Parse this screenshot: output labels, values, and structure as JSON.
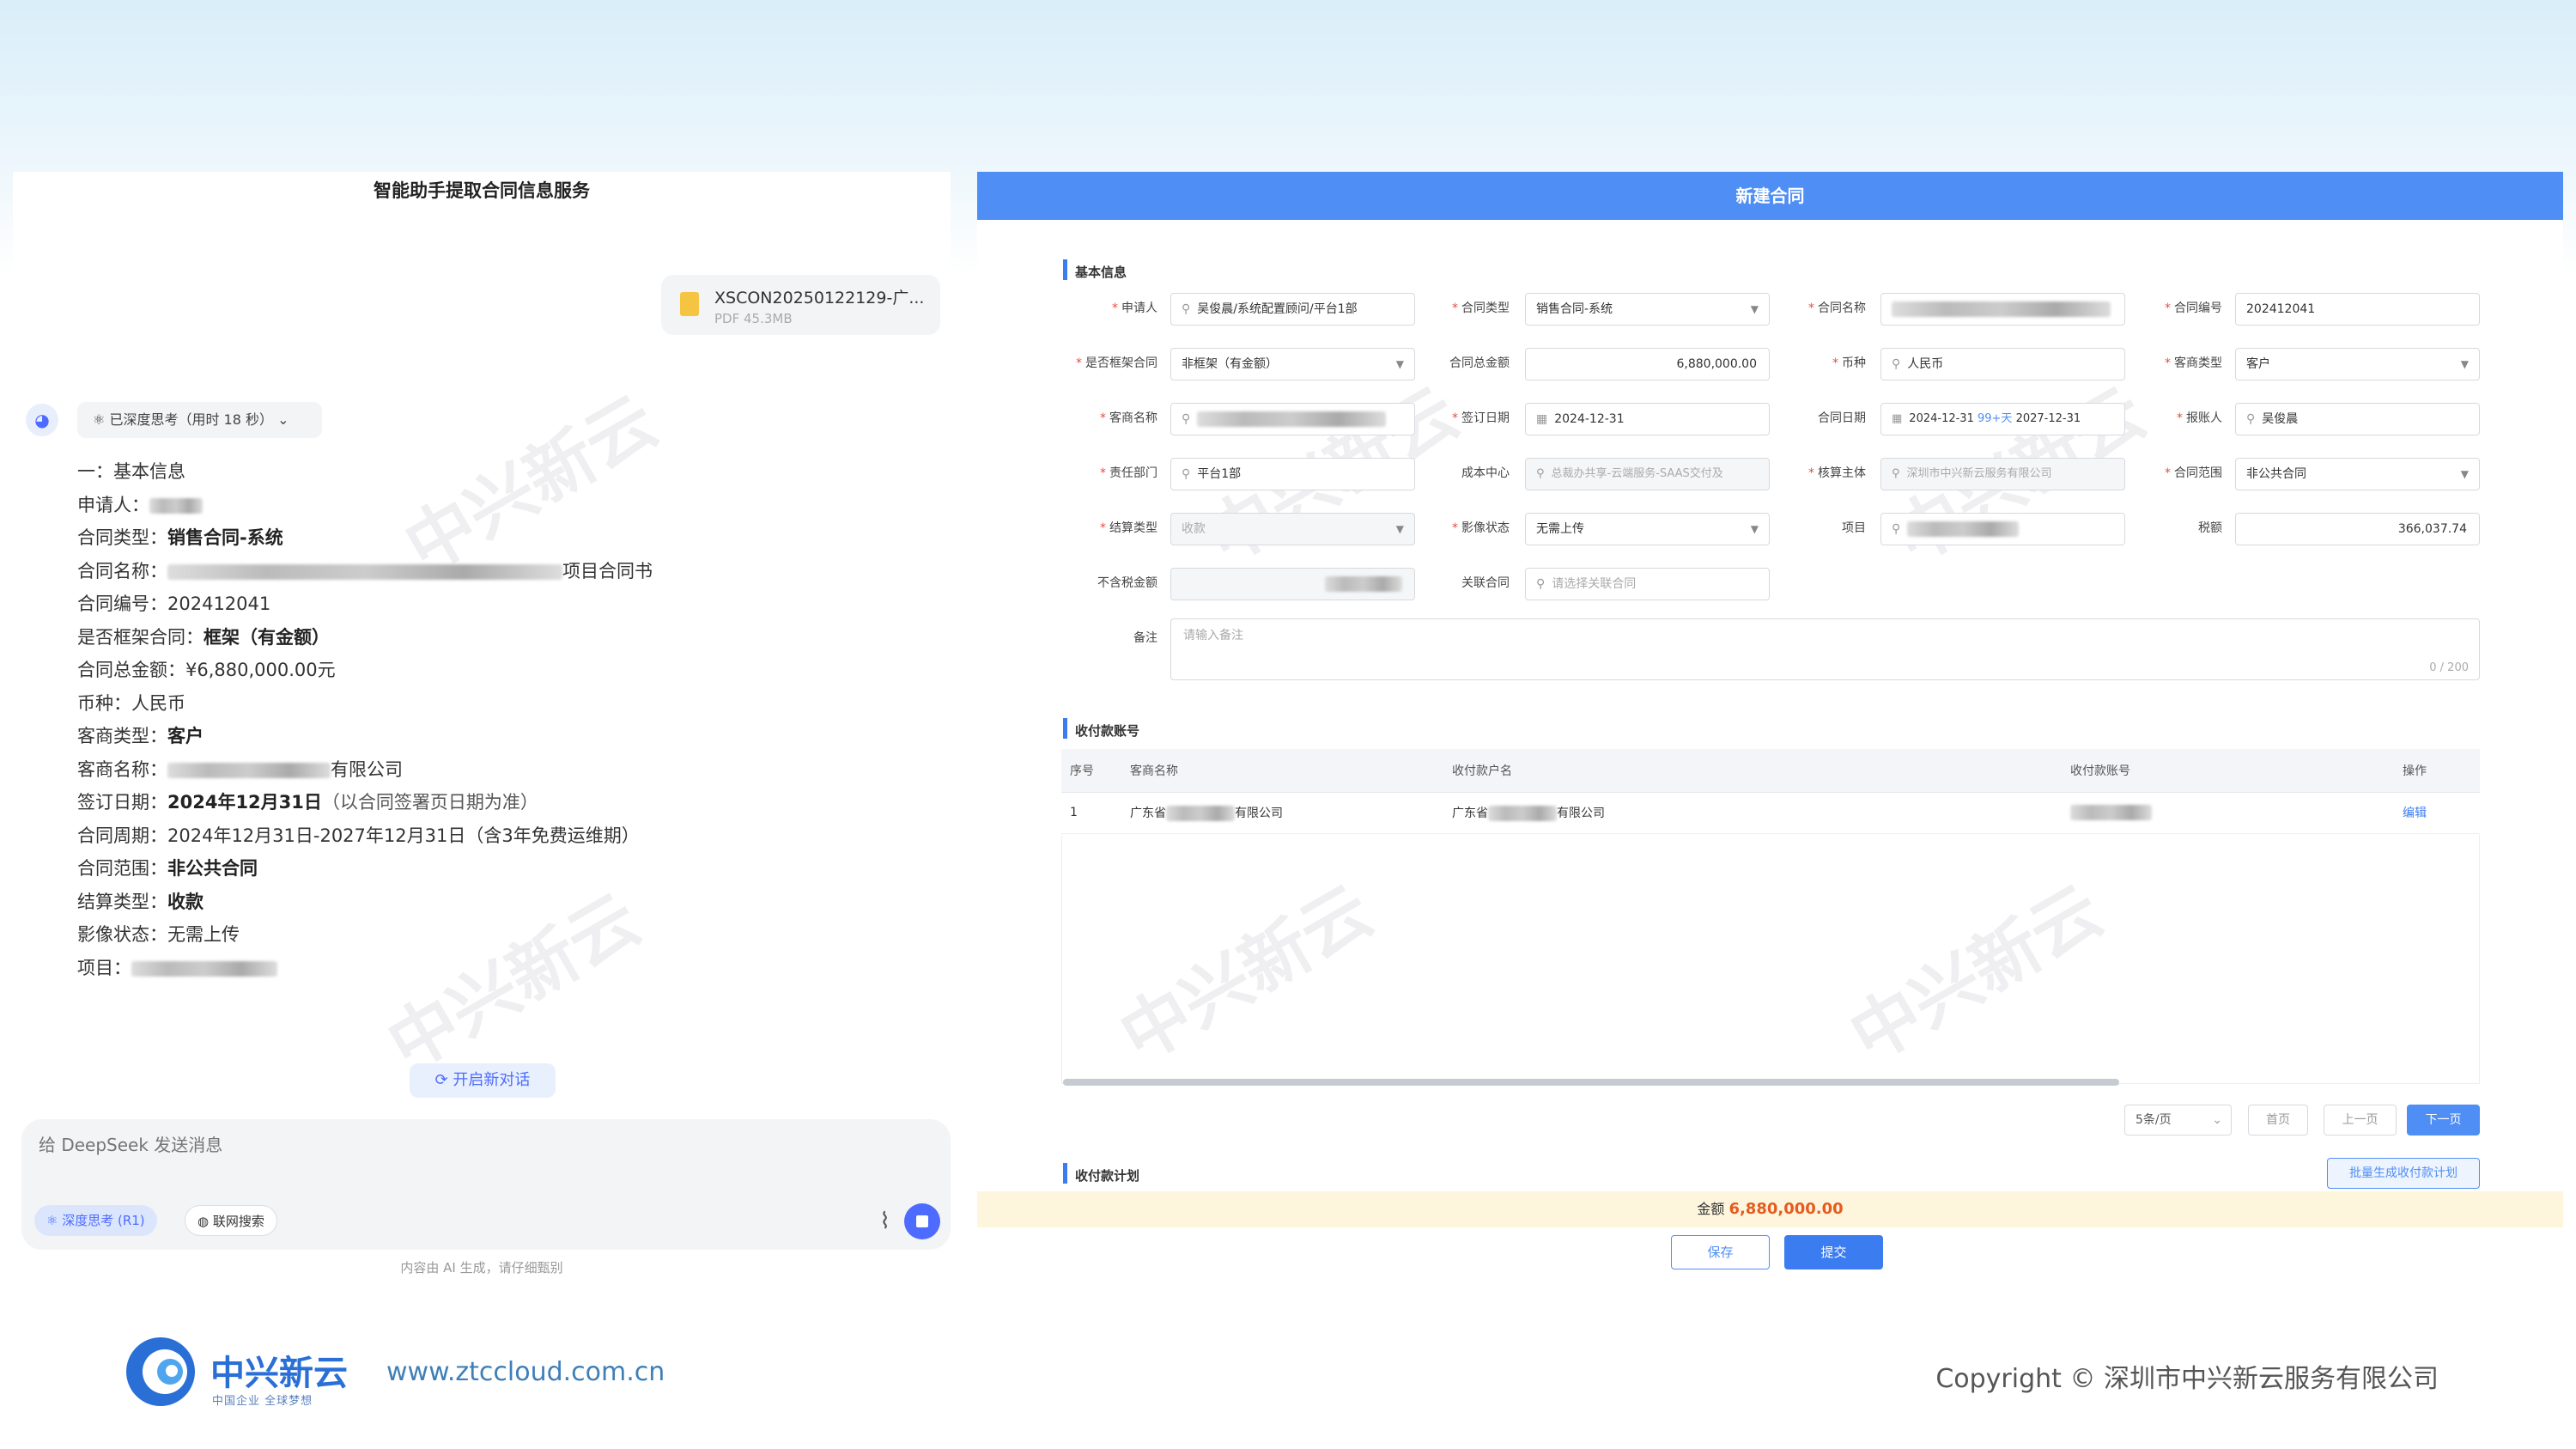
{
  "chat": {
    "title": "智能助手提取合同信息服务",
    "file": {
      "name": "XSCON20250122129-广...",
      "size": "PDF 45.3MB"
    },
    "think_label": "已深度思考（用时 18 秒）",
    "info": [
      {
        "k": "一：基本信息",
        "v": ""
      },
      {
        "k": "申请人：",
        "v": ""
      },
      {
        "k": "合同类型：",
        "v": "销售合同-系统"
      },
      {
        "k": "合同名称：",
        "v": "",
        "suffix": "项目合同书"
      },
      {
        "k": "合同编号：",
        "v": "202412041"
      },
      {
        "k": "是否框架合同：",
        "v": "框架（有金额）"
      },
      {
        "k": "合同总金额：",
        "v": "¥6,880,000.00元"
      },
      {
        "k": "币种：",
        "v": "人民币"
      },
      {
        "k": "客商类型：",
        "v": "客户"
      },
      {
        "k": "客商名称：",
        "v": "",
        "suffix": "有限公司"
      },
      {
        "k": "签订日期：",
        "v": "2024年12月31日",
        "note": "（以合同签署页日期为准）"
      },
      {
        "k": "合同周期：",
        "v": "2024年12月31日-2027年12月31日（含3年免费运维期）"
      },
      {
        "k": "合同范围：",
        "v": "非公共合同"
      },
      {
        "k": "结算类型：",
        "v": "收款"
      },
      {
        "k": "影像状态：",
        "v": "无需上传"
      },
      {
        "k": "项目：",
        "v": ""
      }
    ],
    "new_chat": "开启新对话",
    "composer_placeholder": "给 DeepSeek 发送消息",
    "deep_think": "深度思考 (R1)",
    "web_search": "联网搜索",
    "disclaimer": "内容由 AI 生成，请仔细甄别"
  },
  "form": {
    "header": "新建合同",
    "sections": {
      "basic": "基本信息",
      "account": "收付款账号",
      "plan": "收付款计划"
    },
    "labels": {
      "applicant": "申请人",
      "contract_type": "合同类型",
      "contract_name": "合同名称",
      "contract_no": "合同编号",
      "is_frame": "是否框架合同",
      "total": "合同总金额",
      "currency": "币种",
      "merchant_type": "客商类型",
      "merchant_name": "客商名称",
      "sign_date": "签订日期",
      "period": "合同日期",
      "reporter": "报账人",
      "dept": "责任部门",
      "cost_center": "成本中心",
      "account_entity": "核算主体",
      "scope": "合同范围",
      "settle": "结算类型",
      "image": "影像状态",
      "project": "项目",
      "tax": "税额",
      "no_tax": "不含税金额",
      "related": "关联合同",
      "remark": "备注"
    },
    "values": {
      "applicant": "吴俊晨/系统配置顾问/平台1部",
      "contract_type": "销售合同-系统",
      "contract_no": "202412041",
      "is_frame": "非框架（有金额）",
      "total": "6,880,000.00",
      "currency": "人民币",
      "merchant_type": "客户",
      "sign_date": "2024-12-31",
      "period_start": "2024-12-31",
      "period_mid": "99+天",
      "period_end": "2027-12-31",
      "reporter": "吴俊晨",
      "dept": "平台1部",
      "cost_center": "总裁办共享-云端服务-SAAS交付及",
      "account_entity": "深圳市中兴新云服务有限公司",
      "scope": "非公共合同",
      "settle": "收款",
      "image": "无需上传",
      "tax": "366,037.74",
      "related_placeholder": "请选择关联合同",
      "remark_placeholder": "请输入备注",
      "remark_count": "0 / 200"
    },
    "table": {
      "headers": [
        "序号",
        "客商名称",
        "收付款户名",
        "收付款账号",
        "操作"
      ],
      "row": {
        "no": "1",
        "name_prefix": "广东省",
        "name_suffix": "有限公司",
        "payee_prefix": "广东省",
        "payee_suffix": "有限公司",
        "action": "编辑"
      }
    },
    "pager": {
      "size": "5条/页",
      "first": "首页",
      "prev": "上一页",
      "next": "下一页"
    },
    "plan_button": "批量生成收付款计划",
    "amount_label": "金额",
    "amount_value": "6,880,000.00",
    "save": "保存",
    "submit": "提交"
  },
  "footer": {
    "brand": "中兴新云",
    "slogan": "中国企业 全球梦想",
    "url": "www.ztccloud.com.cn",
    "copyright": "Copyright © 深圳市中兴新云服务有限公司"
  },
  "colors": {
    "accent": "#4f8ef5",
    "brand": "#2a6fd6",
    "amount": "#e65b1e",
    "deepseek": "#4d6bfe"
  }
}
